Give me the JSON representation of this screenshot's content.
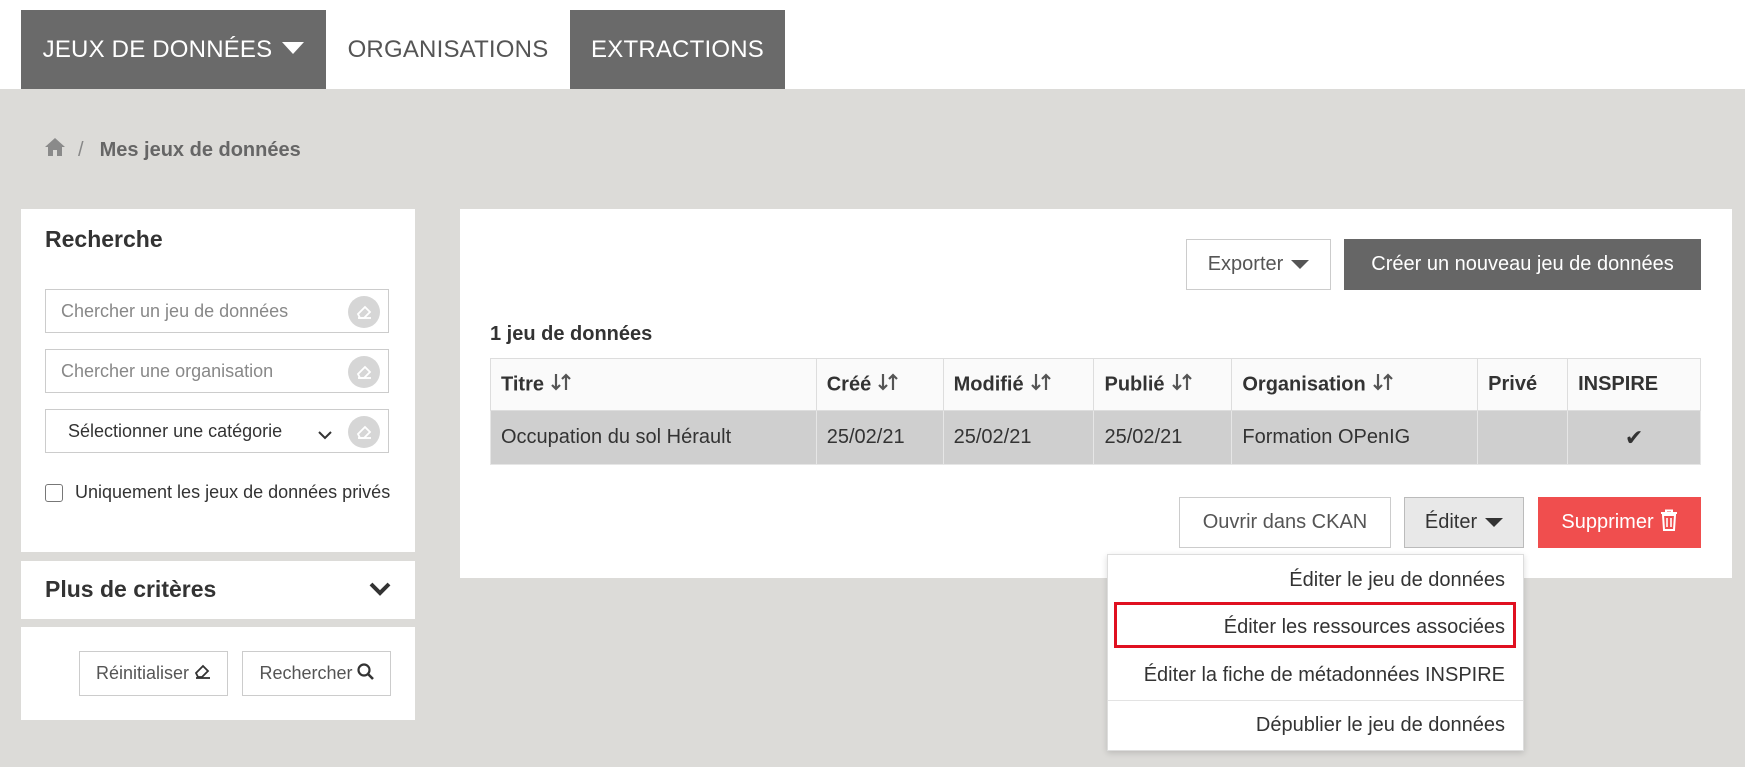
{
  "nav": {
    "tabs": [
      {
        "label": "JEUX DE DONNÉES"
      },
      {
        "label": "ORGANISATIONS"
      },
      {
        "label": "EXTRACTIONS"
      }
    ]
  },
  "breadcrumb": {
    "separator": "/",
    "current": "Mes jeux de données"
  },
  "search": {
    "title": "Recherche",
    "dataset_placeholder": "Chercher un jeu de données",
    "org_placeholder": "Chercher une organisation",
    "category_value": "Sélectionner une catégorie",
    "private_only_label": "Uniquement les jeux de données privés"
  },
  "more_criteria": {
    "title": "Plus de critères"
  },
  "actions_panel": {
    "reset_label": "Réinitialiser",
    "search_label": "Rechercher"
  },
  "main": {
    "export_label": "Exporter",
    "create_label": "Créer un nouveau jeu de données",
    "count_label": "1 jeu de données",
    "table": {
      "headers": [
        "Titre",
        "Créé",
        "Modifié",
        "Publié",
        "Organisation",
        "Privé",
        "INSPIRE"
      ],
      "rows": [
        {
          "title": "Occupation du sol Hérault",
          "created": "25/02/21",
          "modified": "25/02/21",
          "published": "25/02/21",
          "organisation": "Formation OPenIG",
          "private": "",
          "inspire": "✔"
        }
      ]
    },
    "open_ckan_label": "Ouvrir dans CKAN",
    "edit_label": "Éditer",
    "delete_label": "Supprimer",
    "edit_menu": [
      {
        "label": "Éditer le jeu de données"
      },
      {
        "label": "Éditer les ressources associées"
      },
      {
        "label": "Éditer la fiche de métadonnées INSPIRE"
      },
      {
        "label": "Dépublier le jeu de données"
      }
    ]
  },
  "colors": {
    "dark_tab": "#6a6a6a",
    "page_bg": "#dcdbd8",
    "delete_red": "#f04e4e",
    "highlight_red": "#e01020",
    "selected_row": "#cfcfcf"
  }
}
